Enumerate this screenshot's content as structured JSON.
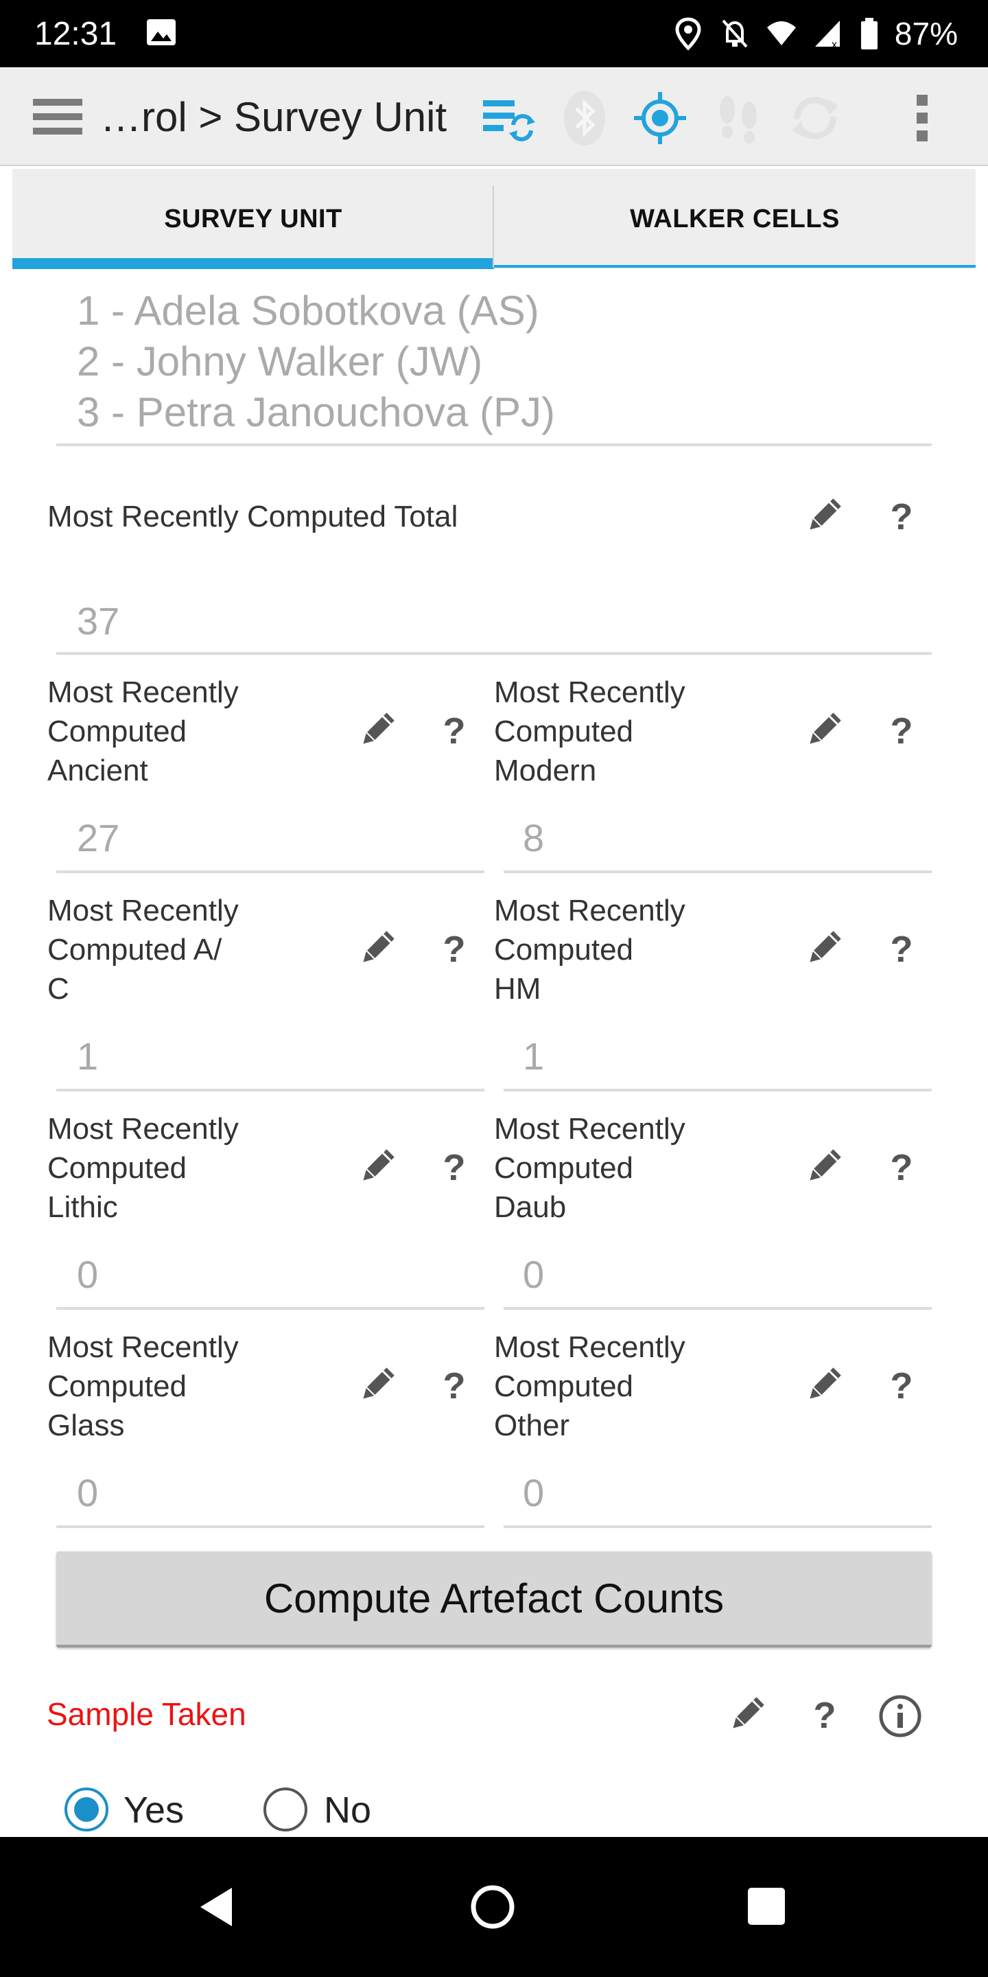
{
  "status_bar": {
    "time": "12:31",
    "battery_percent": "87%",
    "icons": [
      "image-icon",
      "location-icon",
      "notifications-off-icon",
      "wifi-icon",
      "cell-signal-icon",
      "battery-icon"
    ]
  },
  "toolbar": {
    "breadcrumb": "…rol > Survey Unit",
    "icons": [
      "menu-icon",
      "sync-settings-icon",
      "bluetooth-icon",
      "gps-icon",
      "footsteps-icon",
      "refresh-icon",
      "overflow-menu-icon"
    ],
    "accent_color": "#22a3dd"
  },
  "tabs": [
    {
      "label": "SURVEY UNIT",
      "active": true
    },
    {
      "label": "WALKER CELLS",
      "active": false
    }
  ],
  "team": {
    "members": [
      "1 - Adela Sobotkova (AS)",
      "2 - Johny Walker (JW)",
      "3 - Petra Janouchova (PJ)"
    ]
  },
  "total": {
    "label": "Most Recently Computed Total",
    "value": "37"
  },
  "fields": [
    {
      "label_lines": [
        "Most Recently",
        "Computed",
        "Ancient"
      ],
      "value": "27"
    },
    {
      "label_lines": [
        "Most Recently",
        "Computed",
        "Modern"
      ],
      "value": "8"
    },
    {
      "label_lines": [
        "Most Recently",
        "Computed A/",
        "C"
      ],
      "value": "1"
    },
    {
      "label_lines": [
        "Most Recently",
        "Computed",
        "HM"
      ],
      "value": "1"
    },
    {
      "label_lines": [
        "Most Recently",
        "Computed",
        "Lithic"
      ],
      "value": "0"
    },
    {
      "label_lines": [
        "Most Recently",
        "Computed",
        "Daub"
      ],
      "value": "0"
    },
    {
      "label_lines": [
        "Most Recently",
        "Computed",
        "Glass"
      ],
      "value": "0"
    },
    {
      "label_lines": [
        "Most Recently",
        "Computed",
        "Other"
      ],
      "value": "0"
    }
  ],
  "help_mark": "?",
  "compute_button": {
    "label": "Compute Artefact Counts"
  },
  "sample": {
    "label": "Sample Taken",
    "label_color": "#ee1111",
    "options": [
      {
        "label": "Yes",
        "selected": true
      },
      {
        "label": "No",
        "selected": false
      }
    ]
  }
}
